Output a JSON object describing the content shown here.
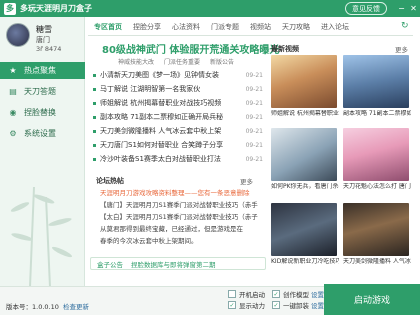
{
  "titlebar": {
    "logo_char": "多",
    "title": "多玩天涯明月刀盒子",
    "feedback": "意见反馈",
    "min_glyph": "−",
    "close_glyph": "✕"
  },
  "profile": {
    "name": "糖雪",
    "sect": "唐门",
    "level": "3ř 8474"
  },
  "sidebar": {
    "items": [
      {
        "label": "热点聚焦",
        "icon": "★"
      },
      {
        "label": "天刀答题",
        "icon": "▤"
      },
      {
        "label": "捏脸替换",
        "icon": "◉"
      },
      {
        "label": "系统设置",
        "icon": "⚙"
      }
    ]
  },
  "tabs": {
    "items": [
      "专区首页",
      "捏脸分享",
      "心法资料",
      "门派专题",
      "视频站",
      "天刀攻略",
      "进入论坛"
    ],
    "refresh_glyph": "↻"
  },
  "headline": {
    "title": "80级战神武门 体验服开荒通关攻略曝光",
    "sub": [
      "神威技能大改",
      "门派任务重要",
      "新版公告"
    ]
  },
  "news": [
    {
      "text": "小清新天刀美图《梦一场》见钟情女装",
      "date": "09-21"
    },
    {
      "text": "马丁解说 江湖明智第一名我家伙",
      "date": "09-21"
    },
    {
      "text": "师姐解说 杭州揭幕替职业对战技巧视频",
      "date": "09-21"
    },
    {
      "text": "副本攻略 71副本二票穆如正确开局兵秘",
      "date": "09-21"
    },
    {
      "text": "天刀美剑微隆播料 人气冰云套中秋上架",
      "date": "09-21"
    },
    {
      "text": "天刀唐门S1如何对替职业 合笑蹲子分享",
      "date": "09-21"
    },
    {
      "text": "冷沙叶装备S1赛季太白对战替职业打法",
      "date": "09-21"
    }
  ],
  "forum": {
    "head": "论坛热帖",
    "more": "更多",
    "posts": [
      "天涯明月刀游戏攻略资料整理——您有一条恶意删除",
      "【唐门】天涯明月刀S1赛季门派对战替职业技巧（赤手",
      "【太白】天涯明月刀S1赛季门派对战替职业技巧（赤子",
      "从莫君那得到最终宝藏，已经通过，但是游戏是在",
      "春季的今次冰云套中秋上架期间。"
    ]
  },
  "announce": {
    "tag": "盒子公告",
    "msg": "捏脸数据库与即将弹窗第二期"
  },
  "videos": {
    "head": "最新视频",
    "more": "更多",
    "items": [
      "师姐解说 杭州揭幕替职业对战技巧视频",
      "副本攻略 71副本二票穆如正确",
      "如何PK你无兵，看唐门杀手教你如何杀人",
      "天刀花魁心法怎么打 唐门配合夫心法拼配",
      "KID解说新职业刀冷吃技巧",
      "天刀美剑微隆播料 人气冰云套中秋上架"
    ]
  },
  "footer": {
    "version": "版本号：1.0.0.10",
    "check_update": "检查更新",
    "opt_autostart": "开机启动",
    "opt_minimize": "创作模型",
    "opt_show": "显示动力",
    "opt_oneclick": "一键卸装",
    "settings": "设置",
    "launch": "启动游戏"
  },
  "colors": {
    "brand": "#2e9e6a",
    "hot": "#e8673a"
  }
}
